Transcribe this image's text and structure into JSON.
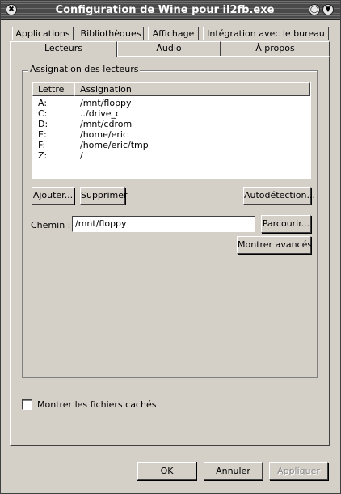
{
  "window": {
    "title": "Configuration de Wine pour il2fb.exe",
    "close_glyph": "✖",
    "shade_glyph": "◯",
    "menu_glyph": "▼"
  },
  "tabs_back": [
    {
      "label": "Applications"
    },
    {
      "label": "Bibliothèques"
    },
    {
      "label": "Affichage"
    },
    {
      "label": "Intégration avec le bureau"
    }
  ],
  "tabs_front": [
    {
      "label": "Lecteurs",
      "active": true
    },
    {
      "label": "Audio",
      "active": false
    },
    {
      "label": "À propos",
      "active": false
    }
  ],
  "drives": {
    "group_label": "Assignation des lecteurs",
    "columns": {
      "letter": "Lettre",
      "mapping": "Assignation"
    },
    "rows": [
      {
        "letter": "A:",
        "path": "/mnt/floppy"
      },
      {
        "letter": "C:",
        "path": "../drive_c"
      },
      {
        "letter": "D:",
        "path": "/mnt/cdrom"
      },
      {
        "letter": "E:",
        "path": "/home/eric"
      },
      {
        "letter": "F:",
        "path": "/home/eric/tmp"
      },
      {
        "letter": "Z:",
        "path": "/"
      }
    ],
    "add_button": "Ajouter...",
    "remove_button": "Supprimer",
    "autodetect_button": "Autodétection...",
    "path_label": "Chemin :",
    "path_value": "/mnt/floppy",
    "browse_button": "Parcourir...",
    "advanced_button": "Montrer avancés"
  },
  "show_hidden": {
    "label": "Montrer les fichiers cachés",
    "checked": false
  },
  "footer": {
    "ok_button": "OK",
    "cancel_button": "Annuler",
    "apply_button": "Appliquer"
  }
}
